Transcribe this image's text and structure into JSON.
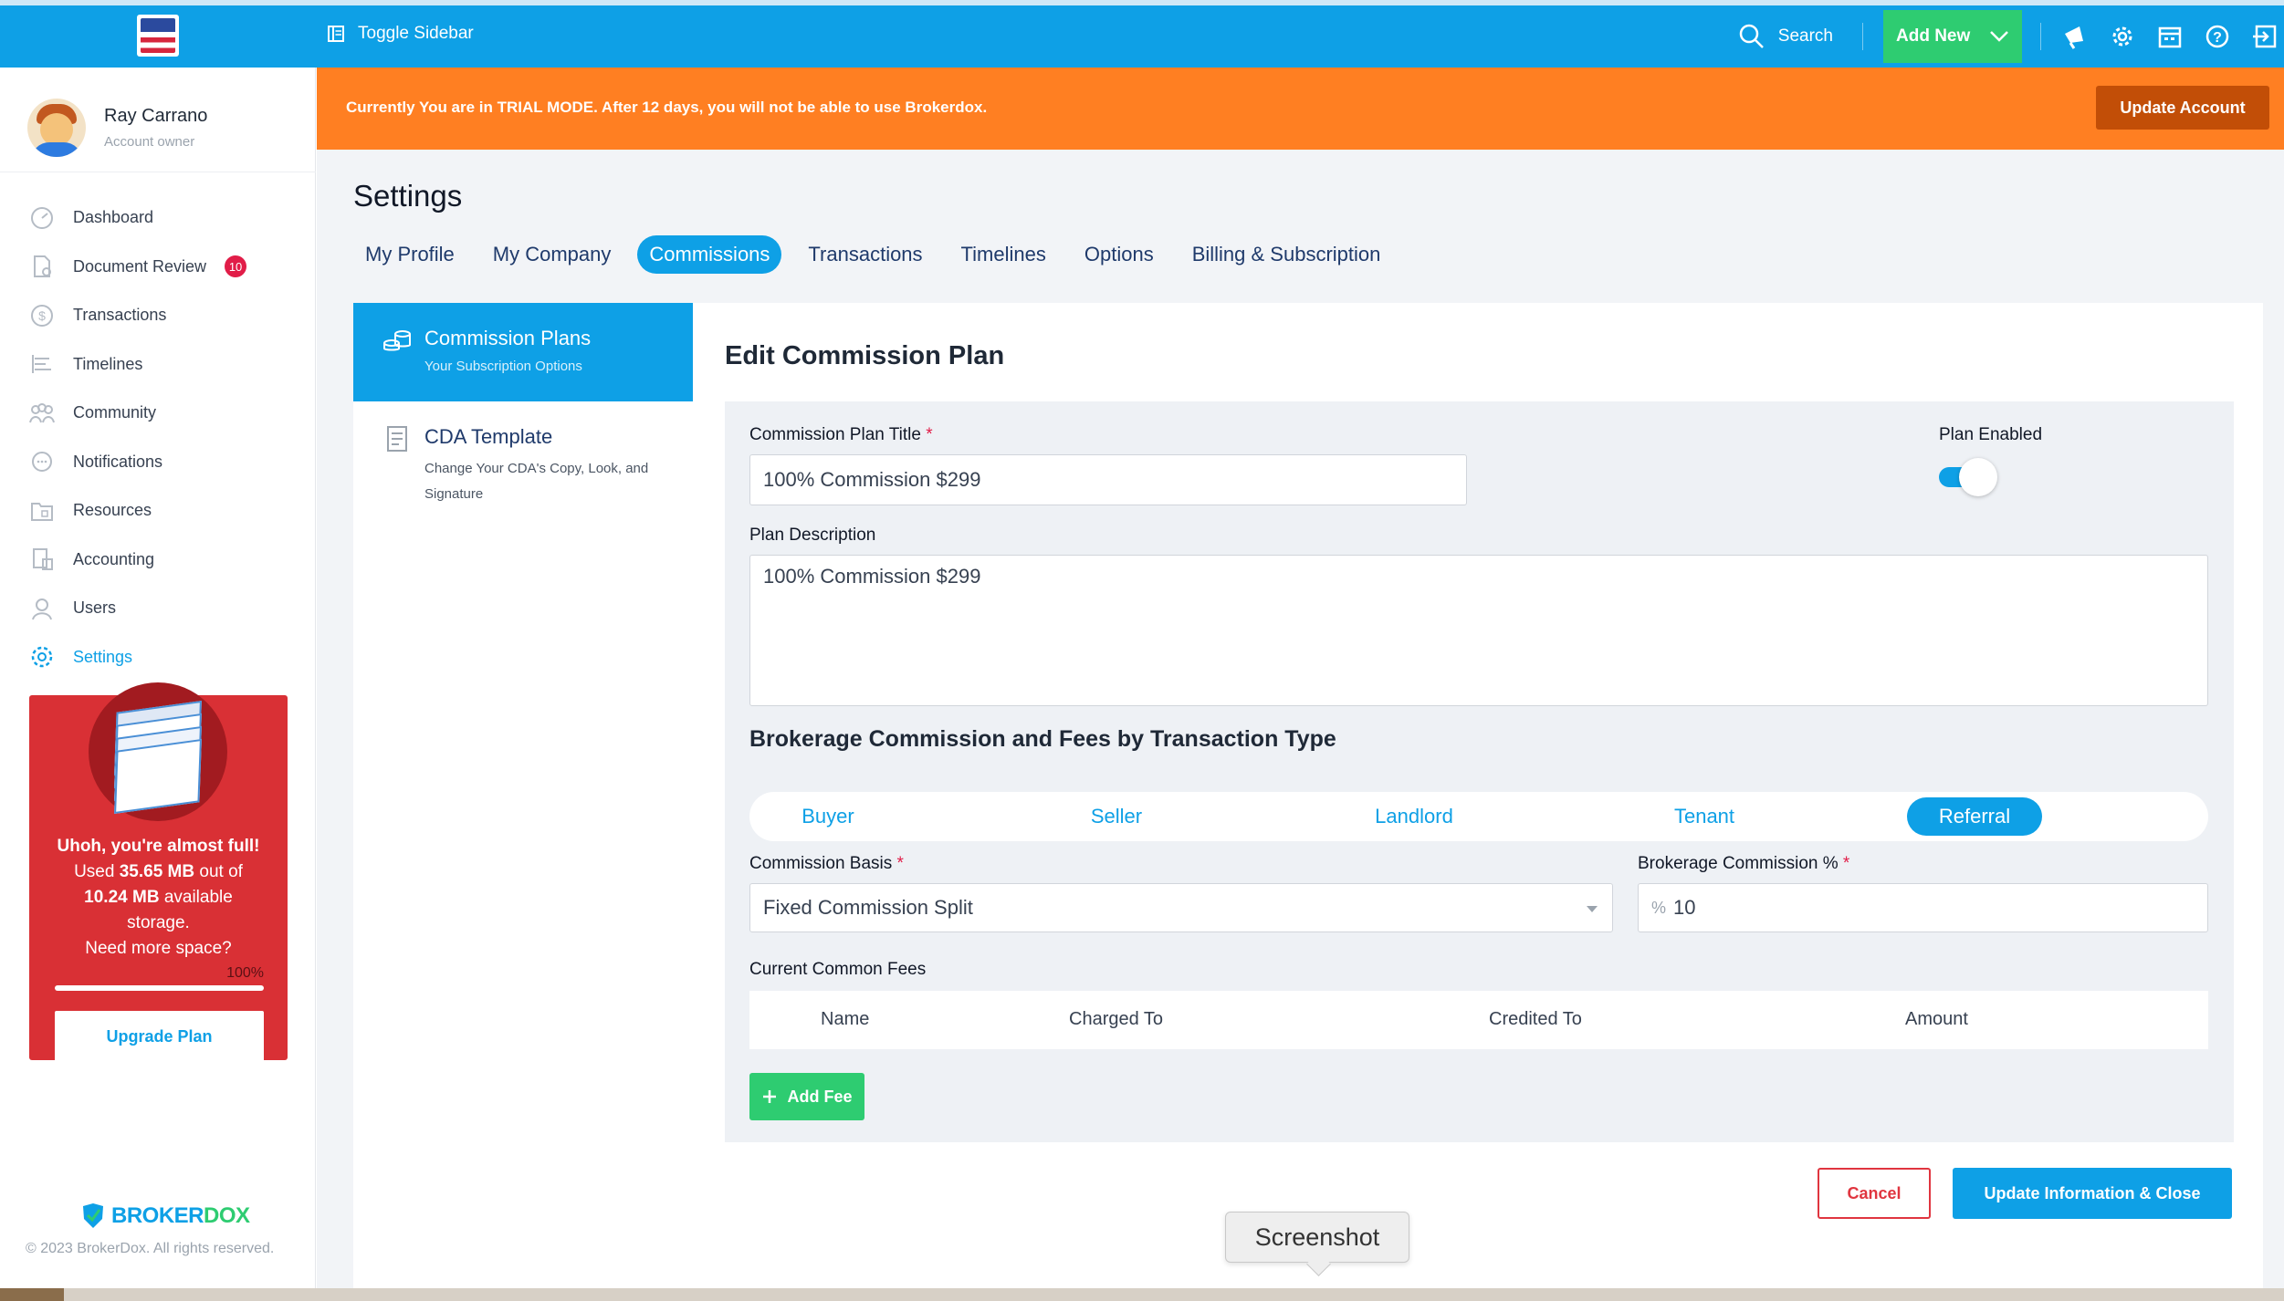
{
  "topbar": {
    "toggle_sidebar": "Toggle Sidebar",
    "search": "Search",
    "add_new": "Add New",
    "icons": [
      "megaphone-icon",
      "gear-icon",
      "calendar-icon",
      "help-icon",
      "logout-icon"
    ]
  },
  "user": {
    "name": "Ray Carrano",
    "role": "Account owner"
  },
  "sidebar": {
    "items": [
      {
        "label": "Dashboard",
        "icon": "gauge-icon"
      },
      {
        "label": "Document Review",
        "icon": "document-icon",
        "badge": "10"
      },
      {
        "label": "Transactions",
        "icon": "dollar-circle-icon"
      },
      {
        "label": "Timelines",
        "icon": "timeline-icon"
      },
      {
        "label": "Community",
        "icon": "people-icon"
      },
      {
        "label": "Notifications",
        "icon": "chat-icon"
      },
      {
        "label": "Resources",
        "icon": "folder-icon"
      },
      {
        "label": "Accounting",
        "icon": "ledger-icon"
      },
      {
        "label": "Users",
        "icon": "user-icon"
      },
      {
        "label": "Settings",
        "icon": "gear-icon",
        "active": true
      }
    ],
    "storage": {
      "line1": "Uhoh, you're almost full!",
      "used_prefix": "Used ",
      "used": "35.65 MB",
      "used_suffix": " out of",
      "available": "10.24 MB",
      "available_suffix": " available storage.",
      "need_more": "Need more space?",
      "percent_label": "100%",
      "percent_value": 100,
      "upgrade_button": "Upgrade Plan"
    },
    "brand": {
      "part1": "BROKER",
      "part2": "DOX"
    },
    "copyright": "© 2023 BrokerDox. All rights reserved."
  },
  "trial_banner": {
    "text": "Currently You are in TRIAL MODE. After 12 days, you will not be able to use Brokerdox.",
    "button": "Update Account"
  },
  "page": {
    "title": "Settings",
    "tabs": [
      {
        "label": "My Profile"
      },
      {
        "label": "My Company"
      },
      {
        "label": "Commissions",
        "active": true
      },
      {
        "label": "Transactions"
      },
      {
        "label": "Timelines"
      },
      {
        "label": "Options"
      },
      {
        "label": "Billing & Subscription"
      }
    ]
  },
  "left_panel": {
    "items": [
      {
        "title": "Commission Plans",
        "subtitle": "Your Subscription Options",
        "active": true
      },
      {
        "title": "CDA Template",
        "subtitle": "Change Your CDA's Copy, Look, and Signature"
      }
    ]
  },
  "editor": {
    "title": "Edit Commission Plan",
    "plan_title_label": "Commission Plan Title",
    "plan_title_value": "100% Commission $299",
    "plan_enabled_label": "Plan Enabled",
    "plan_enabled": true,
    "description_label": "Plan Description",
    "description_value": "100% Commission $299",
    "section_heading": "Brokerage Commission and Fees by Transaction Type",
    "transaction_types": [
      {
        "label": "Buyer"
      },
      {
        "label": "Seller"
      },
      {
        "label": "Landlord"
      },
      {
        "label": "Tenant"
      },
      {
        "label": "Referral",
        "active": true
      }
    ],
    "commission_basis_label": "Commission Basis",
    "commission_basis_value": "Fixed Commission Split",
    "brokerage_commission_label": "Brokerage Commission %",
    "brokerage_commission_prefix": "%",
    "brokerage_commission_value": "10",
    "common_fees_label": "Current Common Fees",
    "fee_columns": [
      "Name",
      "Charged To",
      "Credited To",
      "Amount"
    ],
    "add_fee": "Add Fee",
    "cancel": "Cancel",
    "update": "Update Information & Close"
  },
  "tooltip": {
    "text": "Screenshot"
  }
}
